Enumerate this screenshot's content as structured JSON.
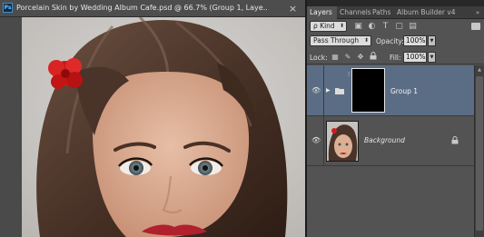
{
  "document": {
    "app_icon_label": "Ps",
    "title": "Porcelain Skin by Wedding Album Cafe.psd @ 66.7% (Group 1, Laye...",
    "close_glyph": "×"
  },
  "panel": {
    "tabs": [
      "Layers",
      "Channels",
      "Paths",
      "Album Builder v4"
    ],
    "menu_glyph": "»",
    "filter": {
      "kind_label": "ρ Kind",
      "icons": [
        "image-icon",
        "adjustment-icon",
        "type-icon",
        "shape-icon",
        "smart-object-icon"
      ]
    },
    "blend_mode": "Pass Through",
    "opacity_label": "Opacity:",
    "opacity_value": "100%",
    "lock_label": "Lock:",
    "lock_icons": [
      "lock-transparent-icon",
      "lock-pixels-icon",
      "lock-position-icon",
      "lock-all-icon"
    ],
    "fill_label": "Fill:",
    "fill_value": "100%",
    "layers": [
      {
        "name": "Group 1",
        "type": "group",
        "selected": true,
        "visible": true
      },
      {
        "name": "Background",
        "type": "pixel",
        "selected": false,
        "visible": true,
        "locked": true
      }
    ]
  },
  "colors": {
    "panel_bg": "#535353",
    "selection": "#5b6d84",
    "doc_bg": "#4a4a4a"
  }
}
